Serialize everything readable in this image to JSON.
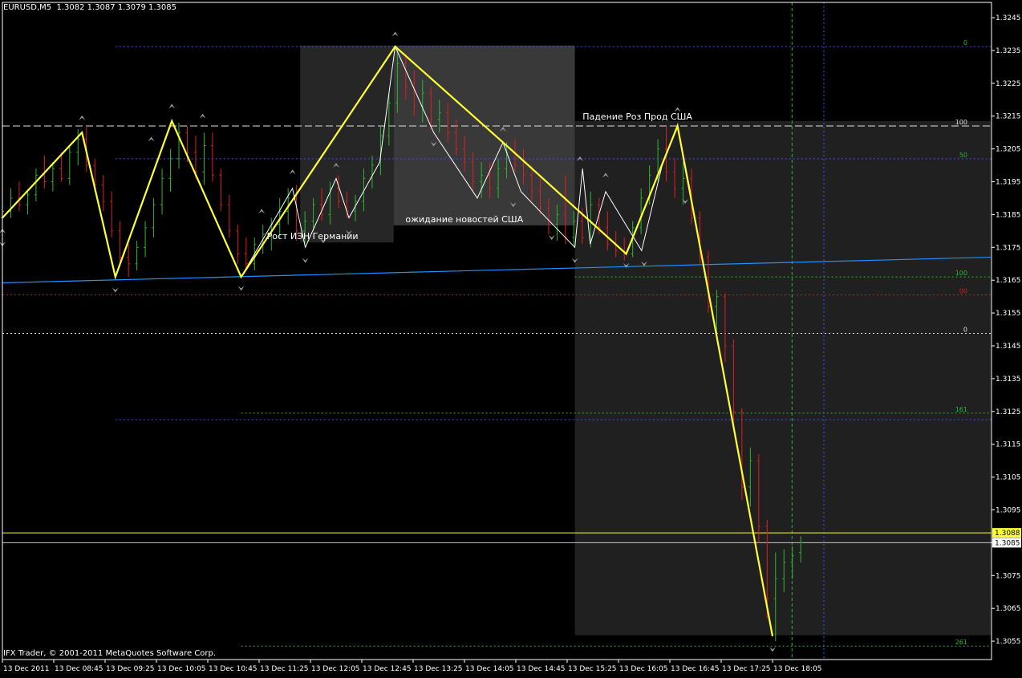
{
  "header": {
    "symbol": "EURUSD,M5",
    "ohlc": "1.3082 1.3087 1.3079 1.3085"
  },
  "footer": {
    "copyright": "IFX Trader, © 2001-2011 MetaQuotes Software Corp."
  },
  "colors": {
    "background": "#000000",
    "bull": "#2fb52f",
    "bear": "#e01e1e",
    "zigzag_major": "#ffff33",
    "zigzag_minor": "#ffffff",
    "trendline": "#1e90ff",
    "level_blue": "#3c50ff",
    "level_green": "#2fb52f",
    "level_red": "#d02020",
    "text": "#ffffff",
    "bid_line": "#ffff33",
    "ask_line": "#c8c8c8"
  },
  "chart_data": {
    "type": "candlestick",
    "instrument": "EURUSD",
    "timeframe": "M5",
    "y_range": [
      1.305,
      1.325
    ],
    "y_ticks": [
      "1.3245",
      "1.3235",
      "1.3225",
      "1.3215",
      "1.3205",
      "1.3195",
      "1.3185",
      "1.3175",
      "1.3165",
      "1.3155",
      "1.3145",
      "1.3135",
      "1.3125",
      "1.3115",
      "1.3105",
      "1.3095",
      "1.3085",
      "1.3075",
      "1.3065",
      "1.3055"
    ],
    "y_tick_values": [
      1.3245,
      1.3235,
      1.3225,
      1.3215,
      1.3205,
      1.3195,
      1.3185,
      1.3175,
      1.3165,
      1.3155,
      1.3145,
      1.3135,
      1.3125,
      1.3115,
      1.3105,
      1.3095,
      1.3085,
      1.3075,
      1.3065,
      1.3055
    ],
    "x_ticks": [
      "13 Dec 2011",
      "13 Dec 08:45",
      "13 Dec 09:25",
      "13 Dec 10:05",
      "13 Dec 10:45",
      "13 Dec 11:25",
      "13 Dec 12:05",
      "13 Dec 12:45",
      "13 Dec 13:25",
      "13 Dec 14:05",
      "13 Dec 14:45",
      "13 Dec 15:25",
      "13 Dec 16:05",
      "13 Dec 16:45",
      "13 Dec 17:25",
      "13 Dec 18:05"
    ],
    "price_labels": {
      "bid": "1.3088",
      "ask": "1.3085",
      "bid_value": 1.3088,
      "ask_value": 1.3085
    },
    "annotations": [
      {
        "text": "Рост ИЭН Германии",
        "time_index": 5.15,
        "price": 1.31765
      },
      {
        "text": "ожидание новостей США",
        "time_index": 7.85,
        "price": 1.31817
      },
      {
        "text": "Падение Роз Прод США",
        "time_index": 11.3,
        "price": 1.3213
      }
    ],
    "shaded_regions": [
      {
        "t0": 5.8,
        "t1": 7.62,
        "p_top": 1.32365,
        "p_bottom": 1.31765,
        "color": "#262626"
      },
      {
        "t0": 7.62,
        "t1": 11.15,
        "p_top": 1.32365,
        "p_bottom": 1.31817,
        "color": "#393939"
      },
      {
        "t0": 11.15,
        "t1": 19.25,
        "p_top": 1.32135,
        "p_bottom": 1.30568,
        "color": "#202020"
      }
    ],
    "horizontal_levels": [
      {
        "price": 1.32362,
        "color": "#3c50ff",
        "style": "dotted",
        "t0": 2.2,
        "label": "0",
        "label_color": "#2fb52f"
      },
      {
        "price": 1.3212,
        "color": "#e0e0e0",
        "style": "dashed",
        "t0": 0,
        "label": "100",
        "label_color": "#e0e0e0"
      },
      {
        "price": 1.3202,
        "color": "#3c50ff",
        "style": "dotted",
        "t0": 2.2,
        "label": "50",
        "label_color": "#2fb52f"
      },
      {
        "price": 1.3166,
        "color": "#2fb52f",
        "style": "dotted",
        "t0": 11.15,
        "label": "100",
        "label_color": "#2fb52f"
      },
      {
        "price": 1.31605,
        "color": "#d02020",
        "style": "dotted",
        "t0": 0,
        "label": "00",
        "label_color": "#d02020"
      },
      {
        "price": 1.31488,
        "color": "#e0e0e0",
        "style": "dotted",
        "t0": 0,
        "label": "0",
        "label_color": "#e0e0e0"
      },
      {
        "price": 1.31225,
        "color": "#3c50ff",
        "style": "dotted",
        "t0": 2.2,
        "label": "",
        "label_color": "#2fb52f"
      },
      {
        "price": 1.31245,
        "color": "#2fb52f",
        "style": "dotted",
        "t0": 4.65,
        "label": "161",
        "label_color": "#2fb52f"
      },
      {
        "price": 1.30535,
        "color": "#2fb52f",
        "style": "dotted",
        "t0": 4.65,
        "label": "261",
        "label_color": "#2fb52f"
      }
    ],
    "vertical_lines": [
      {
        "time_index": 15.38,
        "color": "#2fb52f",
        "style": "dashed"
      },
      {
        "time_index": 16.0,
        "color": "#3c50ff",
        "style": "dotted"
      }
    ],
    "trendline": {
      "t0": 0,
      "p0": 1.31642,
      "t1": 19.25,
      "p1": 1.3172,
      "color": "#1e90ff"
    },
    "zigzag_major": [
      [
        0.0,
        1.3184
      ],
      [
        1.55,
        1.321
      ],
      [
        2.2,
        1.3166
      ],
      [
        3.3,
        1.32135
      ],
      [
        4.65,
        1.3166
      ],
      [
        7.65,
        1.32362
      ],
      [
        9.75,
        1.3207
      ],
      [
        12.15,
        1.3173
      ],
      [
        13.15,
        1.3212
      ],
      [
        15.0,
        1.30565
      ]
    ],
    "zigzag_minor": [
      [
        4.65,
        1.3166
      ],
      [
        5.65,
        1.3193
      ],
      [
        5.9,
        1.3175
      ],
      [
        6.5,
        1.3196
      ],
      [
        6.75,
        1.3184
      ],
      [
        7.35,
        1.3201
      ],
      [
        7.65,
        1.32362
      ],
      [
        8.4,
        1.321
      ],
      [
        9.25,
        1.319
      ],
      [
        9.75,
        1.3207
      ],
      [
        10.1,
        1.3192
      ],
      [
        11.15,
        1.3175
      ],
      [
        11.3,
        1.3199
      ],
      [
        11.45,
        1.3176
      ],
      [
        11.75,
        1.3192
      ],
      [
        12.45,
        1.3174
      ],
      [
        12.85,
        1.32
      ],
      [
        13.15,
        1.3212
      ],
      [
        13.4,
        1.3192
      ]
    ],
    "fractals_up": [
      [
        1.55,
        1.32145
      ],
      [
        3.3,
        1.3218
      ],
      [
        3.9,
        1.3215
      ],
      [
        2.9,
        1.3208
      ],
      [
        5.65,
        1.3198
      ],
      [
        6.5,
        1.32
      ],
      [
        7.65,
        1.324
      ],
      [
        9.75,
        1.3211
      ],
      [
        11.25,
        1.3202
      ],
      [
        11.75,
        1.3197
      ],
      [
        13.15,
        1.3217
      ],
      [
        5.05,
        1.3186
      ],
      [
        0.0,
        1.318
      ]
    ],
    "fractals_down": [
      [
        2.2,
        1.3162
      ],
      [
        4.65,
        1.31625
      ],
      [
        5.9,
        1.3171
      ],
      [
        6.75,
        1.31795
      ],
      [
        8.4,
        1.32065
      ],
      [
        9.95,
        1.3188
      ],
      [
        10.7,
        1.3178
      ],
      [
        11.15,
        1.3171
      ],
      [
        12.15,
        1.31695
      ],
      [
        12.5,
        1.317
      ],
      [
        13.3,
        1.3189
      ],
      [
        15.0,
        1.30525
      ],
      [
        6.25,
        1.3177
      ],
      [
        0.0,
        1.3176
      ]
    ],
    "candles": [
      [
        1.3184,
        1.3189,
        1.3181,
        1.3186
      ],
      [
        1.3186,
        1.3193,
        1.3184,
        1.319
      ],
      [
        1.319,
        1.3195,
        1.3186,
        1.3188
      ],
      [
        1.3188,
        1.3192,
        1.3185,
        1.3191
      ],
      [
        1.3191,
        1.3199,
        1.3189,
        1.3197
      ],
      [
        1.3197,
        1.3203,
        1.3193,
        1.3195
      ],
      [
        1.3195,
        1.3201,
        1.3192,
        1.3199
      ],
      [
        1.3199,
        1.3204,
        1.3195,
        1.3196
      ],
      [
        1.3196,
        1.3206,
        1.3194,
        1.3204
      ],
      [
        1.3204,
        1.3211,
        1.32,
        1.3208
      ],
      [
        1.3208,
        1.3212,
        1.3198,
        1.32
      ],
      [
        1.32,
        1.3202,
        1.3192,
        1.3194
      ],
      [
        1.3194,
        1.3197,
        1.3186,
        1.3189
      ],
      [
        1.3189,
        1.3192,
        1.3178,
        1.318
      ],
      [
        1.318,
        1.3183,
        1.3169,
        1.3172
      ],
      [
        1.3172,
        1.3176,
        1.3166,
        1.317
      ],
      [
        1.317,
        1.3177,
        1.3168,
        1.3175
      ],
      [
        1.3175,
        1.3183,
        1.3172,
        1.3181
      ],
      [
        1.3181,
        1.319,
        1.3178,
        1.3188
      ],
      [
        1.3188,
        1.3199,
        1.3185,
        1.3196
      ],
      [
        1.3196,
        1.3205,
        1.3192,
        1.3202
      ],
      [
        1.3202,
        1.3213,
        1.3199,
        1.321
      ],
      [
        1.321,
        1.3212,
        1.3201,
        1.3204
      ],
      [
        1.3204,
        1.3209,
        1.3196,
        1.3198
      ],
      [
        1.3198,
        1.321,
        1.3194,
        1.3206
      ],
      [
        1.3206,
        1.321,
        1.3195,
        1.3197
      ],
      [
        1.3197,
        1.3199,
        1.3186,
        1.3188
      ],
      [
        1.3188,
        1.3191,
        1.3178,
        1.318
      ],
      [
        1.318,
        1.3182,
        1.317,
        1.3173
      ],
      [
        1.3173,
        1.3178,
        1.3168,
        1.317
      ],
      [
        1.317,
        1.3178,
        1.3168,
        1.3176
      ],
      [
        1.3176,
        1.3182,
        1.3173,
        1.3179
      ],
      [
        1.3179,
        1.3184,
        1.3174,
        1.3182
      ],
      [
        1.3182,
        1.319,
        1.3178,
        1.3186
      ],
      [
        1.3186,
        1.3193,
        1.3182,
        1.319
      ],
      [
        1.319,
        1.3194,
        1.3177,
        1.318
      ],
      [
        1.318,
        1.3186,
        1.3176,
        1.3183
      ],
      [
        1.3183,
        1.319,
        1.318,
        1.3188
      ],
      [
        1.3188,
        1.3193,
        1.3183,
        1.3185
      ],
      [
        1.3185,
        1.3195,
        1.3182,
        1.3193
      ],
      [
        1.3193,
        1.3197,
        1.3187,
        1.3189
      ],
      [
        1.3189,
        1.3192,
        1.3184,
        1.3186
      ],
      [
        1.3186,
        1.3191,
        1.3183,
        1.3189
      ],
      [
        1.3189,
        1.3199,
        1.3186,
        1.3196
      ],
      [
        1.3196,
        1.3203,
        1.3193,
        1.32
      ],
      [
        1.32,
        1.3212,
        1.3197,
        1.3209
      ],
      [
        1.3209,
        1.3222,
        1.3206,
        1.3219
      ],
      [
        1.3219,
        1.3236,
        1.3216,
        1.3231
      ],
      [
        1.3231,
        1.3234,
        1.322,
        1.3224
      ],
      [
        1.3224,
        1.3229,
        1.3215,
        1.3218
      ],
      [
        1.3218,
        1.3226,
        1.3213,
        1.3222
      ],
      [
        1.3222,
        1.3224,
        1.3211,
        1.3214
      ],
      [
        1.3214,
        1.322,
        1.321,
        1.3216
      ],
      [
        1.3216,
        1.3219,
        1.3207,
        1.321
      ],
      [
        1.321,
        1.3214,
        1.3203,
        1.3205
      ],
      [
        1.3205,
        1.3209,
        1.3198,
        1.3201
      ],
      [
        1.3201,
        1.3204,
        1.3192,
        1.3195
      ],
      [
        1.3195,
        1.3201,
        1.319,
        1.3197
      ],
      [
        1.3197,
        1.3201,
        1.319,
        1.3193
      ],
      [
        1.3193,
        1.3202,
        1.319,
        1.3199
      ],
      [
        1.3199,
        1.3207,
        1.3196,
        1.3204
      ],
      [
        1.3204,
        1.3208,
        1.3198,
        1.32
      ],
      [
        1.32,
        1.3205,
        1.3194,
        1.3197
      ],
      [
        1.3197,
        1.32,
        1.3189,
        1.3192
      ],
      [
        1.3192,
        1.3196,
        1.3185,
        1.3187
      ],
      [
        1.3187,
        1.319,
        1.3179,
        1.3182
      ],
      [
        1.3182,
        1.3188,
        1.3177,
        1.3185
      ],
      [
        1.3185,
        1.3197,
        1.3176,
        1.3178
      ],
      [
        1.3178,
        1.3186,
        1.3175,
        1.3183
      ],
      [
        1.3183,
        1.3187,
        1.3176,
        1.3178
      ],
      [
        1.3178,
        1.3192,
        1.3175,
        1.3188
      ],
      [
        1.3188,
        1.319,
        1.3179,
        1.3181
      ],
      [
        1.3181,
        1.3186,
        1.3174,
        1.3176
      ],
      [
        1.3176,
        1.318,
        1.3172,
        1.3174
      ],
      [
        1.3174,
        1.3178,
        1.3171,
        1.3173
      ],
      [
        1.3173,
        1.3183,
        1.3172,
        1.3181
      ],
      [
        1.3181,
        1.3193,
        1.3179,
        1.319
      ],
      [
        1.319,
        1.32,
        1.3188,
        1.3197
      ],
      [
        1.3197,
        1.3208,
        1.3195,
        1.3205
      ],
      [
        1.3205,
        1.3212,
        1.3195,
        1.3198
      ],
      [
        1.3198,
        1.3202,
        1.319,
        1.3193
      ],
      [
        1.3193,
        1.3201,
        1.3188,
        1.3196
      ],
      [
        1.3196,
        1.3199,
        1.3182,
        1.3184
      ],
      [
        1.3184,
        1.3186,
        1.317,
        1.3172
      ],
      [
        1.3172,
        1.3174,
        1.3155,
        1.3157
      ],
      [
        1.3157,
        1.3162,
        1.3148,
        1.316
      ],
      [
        1.316,
        1.3161,
        1.314,
        1.3145
      ],
      [
        1.3145,
        1.3147,
        1.312,
        1.3125
      ],
      [
        1.3125,
        1.3126,
        1.3098,
        1.3102
      ],
      [
        1.3102,
        1.3114,
        1.3096,
        1.311
      ],
      [
        1.311,
        1.3112,
        1.3085,
        1.309
      ],
      [
        1.309,
        1.3092,
        1.3062,
        1.3068
      ],
      [
        1.3068,
        1.3082,
        1.3055,
        1.3074
      ],
      [
        1.3074,
        1.3083,
        1.307,
        1.3079
      ],
      [
        1.3079,
        1.3084,
        1.3074,
        1.3081
      ],
      [
        1.3082,
        1.3087,
        1.3079,
        1.3085
      ]
    ]
  }
}
